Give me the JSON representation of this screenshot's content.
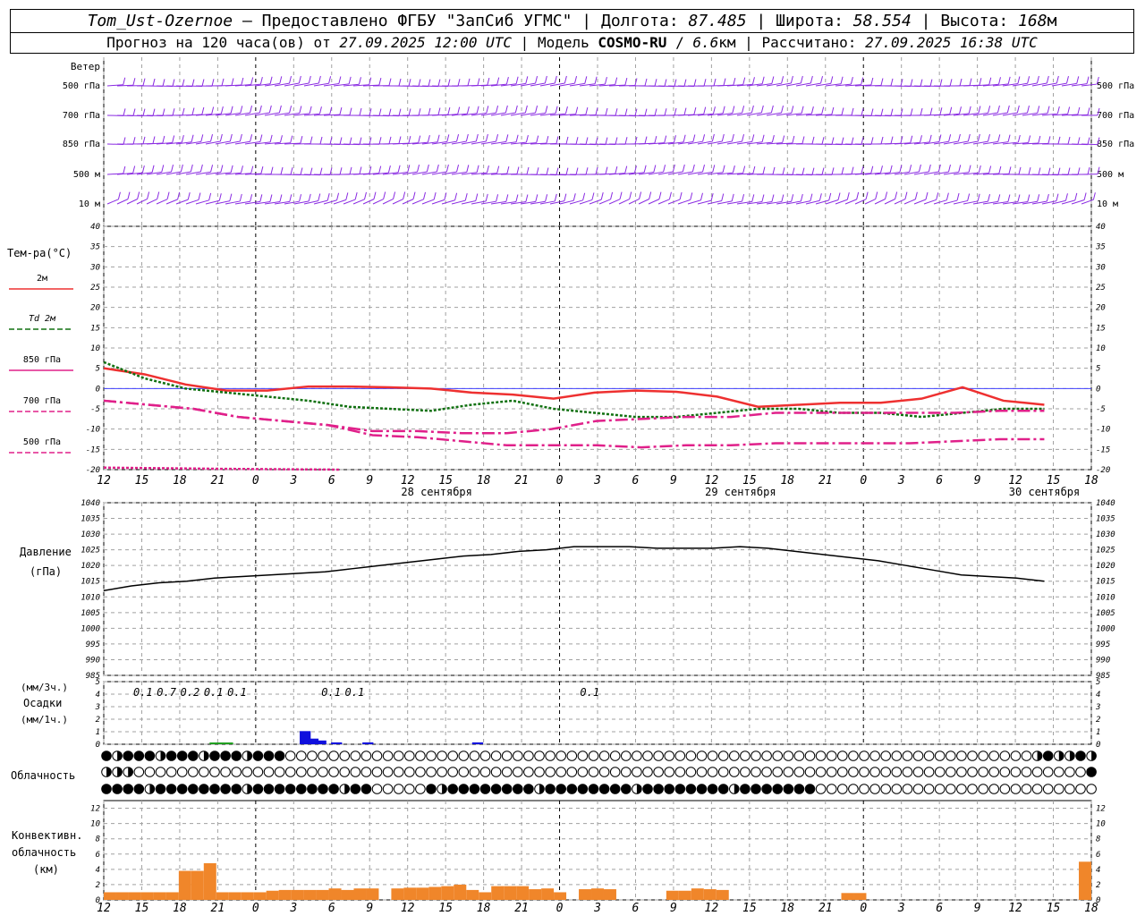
{
  "header": {
    "station": "Tom_Ust-Ozernoe",
    "provider": "Предоставлено ФГБУ \"ЗапСиб УГМС\"",
    "lon_label": "Долгота:",
    "lon_value": "87.485",
    "lat_label": "Широта:",
    "lat_value": "58.554",
    "alt_label": "Высота:",
    "alt_value": "168",
    "alt_unit": "м",
    "forecast_prefix": "Прогноз на 120 часа(ов) от",
    "forecast_time": "27.09.2025 12:00 UTC",
    "model_label": "Модель",
    "model_name": "COSMO-RU",
    "model_res": "6.6",
    "model_res_unit": "км",
    "computed_label": "Рассчитано:",
    "computed_time": "27.09.2025 16:38 UTC",
    "sep": "|",
    "dash": "—"
  },
  "colors": {
    "wind": "#8a2be2",
    "t2m": "#ee3030",
    "td2m": "#107010",
    "t850": "#e0208a",
    "t700": "#e0208a",
    "t500": "#e0208a",
    "pressure": "#000000",
    "precip3h": "#1010dd",
    "precip1h": "#20a020",
    "convective": "#f0862a",
    "grid": "#a0a0a0",
    "zero_line": "#4040ff"
  },
  "chart_data": [
    {
      "panel": "wind",
      "type": "wind_barbs",
      "title": "Ветер",
      "levels": [
        "500 гПа",
        "700 гПа",
        "850 гПа",
        "500 м",
        "10 м"
      ]
    },
    {
      "panel": "temperature",
      "type": "line",
      "ylabel": "Тем-ра(°C)",
      "ylim": [
        -20,
        40
      ],
      "yticks": [
        -20,
        -15,
        -10,
        -5,
        0,
        5,
        10,
        15,
        20,
        25,
        30,
        35,
        40
      ],
      "x_hours": [
        0,
        6,
        12,
        18,
        24,
        30,
        36,
        42,
        48,
        54,
        60,
        66,
        72,
        78,
        84,
        90,
        96,
        102,
        108,
        114,
        120,
        126
      ],
      "series": [
        {
          "name": "2м",
          "key": "t2m",
          "style": "solid",
          "values": [
            5,
            3.5,
            1,
            -0.5,
            -0.5,
            0.5,
            0.5,
            0.3,
            0,
            -1,
            -1.5,
            -2.5,
            -1,
            -0.5,
            -0.8,
            -2,
            -4.5,
            -4,
            -3.5,
            -3.5,
            -2.5,
            0.3,
            -3,
            -4
          ]
        },
        {
          "name": "Td 2м",
          "key": "td2m",
          "style": "dotted",
          "values": [
            6.5,
            2.5,
            0,
            -1,
            -2,
            -3,
            -4.5,
            -5,
            -5.5,
            -4,
            -3,
            -5,
            -6,
            -7,
            -7,
            -6,
            -5,
            -5,
            -6,
            -6,
            -7,
            -6,
            -5,
            -5
          ]
        },
        {
          "name": "850 гПа",
          "key": "t850",
          "style": "dashdot",
          "values": [
            -3,
            -4,
            -5,
            -7,
            -8,
            -9,
            -10.5,
            -10.5,
            -11,
            -11,
            -10,
            -8,
            -7.5,
            -7,
            -7,
            -6,
            -6,
            -6,
            -6,
            -6,
            -5.5,
            -5.5
          ]
        },
        {
          "name": "700 гПа",
          "key": "t700",
          "style": "dashdot",
          "values": [
            -3,
            -4,
            -5,
            -7,
            -8,
            -9,
            -11.5,
            -12,
            -13,
            -14,
            -14,
            -14,
            -14.5,
            -14,
            -14,
            -13.5,
            -13.5,
            -13.5,
            -13.5,
            -13,
            -12.5,
            -12.5
          ]
        },
        {
          "name": "500 гПа",
          "key": "t500",
          "style": "dotted",
          "values": [
            -19.5,
            -19.8,
            -20
          ]
        }
      ]
    },
    {
      "panel": "pressure",
      "type": "line",
      "ylabel": "Давление (гПа)",
      "ylim": [
        985,
        1040
      ],
      "yticks": [
        985,
        990,
        995,
        1000,
        1005,
        1010,
        1015,
        1020,
        1025,
        1030,
        1035,
        1040
      ],
      "series": [
        {
          "name": "",
          "values": [
            1012,
            1013.5,
            1014.5,
            1015,
            1016,
            1016.5,
            1017,
            1017.5,
            1018,
            1019,
            1020,
            1021,
            1022,
            1023,
            1023.5,
            1024.5,
            1025,
            1026,
            1026,
            1026,
            1025.5,
            1025.5,
            1025.5,
            1026,
            1025.5,
            1024.5,
            1023.5,
            1022.5,
            1021.5,
            1020,
            1018.5,
            1017,
            1016.5,
            1016,
            1015
          ]
        }
      ]
    },
    {
      "panel": "precipitation",
      "type": "bar",
      "ylabel_3h": "(мм/3ч.)",
      "title": "Осадки",
      "ylabel_1h": "(мм/1ч.)",
      "ylim": [
        0,
        5
      ],
      "labels": [
        {
          "hour": 5,
          "text": "0.1"
        },
        {
          "hour": 8,
          "text": "0.7"
        },
        {
          "hour": 11,
          "text": "0.2"
        },
        {
          "hour": 14,
          "text": "0.1"
        },
        {
          "hour": 17,
          "text": "0.1"
        },
        {
          "hour": 29,
          "text": "0.1"
        },
        {
          "hour": 32,
          "text": "0.1"
        },
        {
          "hour": 62,
          "text": "0.1"
        }
      ],
      "bars_3h": [
        {
          "hour": 8.5,
          "value": 0.7
        },
        {
          "hour": 9.5,
          "value": 0.3
        },
        {
          "hour": 10.5,
          "value": 0.2
        },
        {
          "hour": 12.5,
          "value": 0.1
        },
        {
          "hour": 16.5,
          "value": 0.1
        },
        {
          "hour": 30.5,
          "value": 0.1
        }
      ],
      "bars_1h": [
        {
          "hour": 4.5,
          "value": 0.05
        },
        {
          "hour": 5.5,
          "value": 0.05
        }
      ]
    },
    {
      "panel": "cloudiness",
      "type": "table",
      "title": "Облачность",
      "rows": [
        "upper",
        "middle",
        "lower"
      ]
    },
    {
      "panel": "convective",
      "type": "bar",
      "ylabel": "Конвективн. облачность (км)",
      "ylim": [
        0,
        13
      ],
      "yticks": [
        0,
        2,
        4,
        6,
        8,
        10,
        12
      ],
      "values": [
        {
          "hour": 0,
          "value": 1
        },
        {
          "hour": 1,
          "value": 1
        },
        {
          "hour": 2,
          "value": 1
        },
        {
          "hour": 3,
          "value": 1
        },
        {
          "hour": 4,
          "value": 1
        },
        {
          "hour": 5,
          "value": 1
        },
        {
          "hour": 6,
          "value": 3.8
        },
        {
          "hour": 7,
          "value": 3.8
        },
        {
          "hour": 8,
          "value": 4.8
        },
        {
          "hour": 9,
          "value": 1
        },
        {
          "hour": 10,
          "value": 1
        },
        {
          "hour": 11,
          "value": 1
        },
        {
          "hour": 12,
          "value": 1
        },
        {
          "hour": 13,
          "value": 1.2
        },
        {
          "hour": 14,
          "value": 1.3
        },
        {
          "hour": 15,
          "value": 1.3
        },
        {
          "hour": 16,
          "value": 1.3
        },
        {
          "hour": 17,
          "value": 1.3
        },
        {
          "hour": 18,
          "value": 1.5
        },
        {
          "hour": 19,
          "value": 1.3
        },
        {
          "hour": 20,
          "value": 1.5
        },
        {
          "hour": 21,
          "value": 1.5
        },
        {
          "hour": 23,
          "value": 1.5
        },
        {
          "hour": 24,
          "value": 1.6
        },
        {
          "hour": 25,
          "value": 1.6
        },
        {
          "hour": 26,
          "value": 1.7
        },
        {
          "hour": 27,
          "value": 1.8
        },
        {
          "hour": 28,
          "value": 2.0
        },
        {
          "hour": 29,
          "value": 1.3
        },
        {
          "hour": 30,
          "value": 1.0
        },
        {
          "hour": 31,
          "value": 1.8
        },
        {
          "hour": 32,
          "value": 1.8
        },
        {
          "hour": 33,
          "value": 1.8
        },
        {
          "hour": 34,
          "value": 1.4
        },
        {
          "hour": 35,
          "value": 1.5
        },
        {
          "hour": 36,
          "value": 1.0
        },
        {
          "hour": 38,
          "value": 1.4
        },
        {
          "hour": 39,
          "value": 1.5
        },
        {
          "hour": 40,
          "value": 1.4
        },
        {
          "hour": 45,
          "value": 1.2
        },
        {
          "hour": 46,
          "value": 1.2
        },
        {
          "hour": 47,
          "value": 1.5
        },
        {
          "hour": 48,
          "value": 1.4
        },
        {
          "hour": 49,
          "value": 1.3
        },
        {
          "hour": 59,
          "value": 0.9
        },
        {
          "hour": 60,
          "value": 0.9
        },
        {
          "hour": 78,
          "value": 5.0
        }
      ]
    }
  ],
  "time_axis": {
    "hour_labels": [
      "12",
      "15",
      "18",
      "21",
      "0",
      "3",
      "6",
      "9",
      "12",
      "15",
      "18",
      "21",
      "0",
      "3",
      "6",
      "9",
      "12",
      "15",
      "18",
      "21",
      "0",
      "3",
      "6",
      "9",
      "12",
      "15",
      "18"
    ],
    "day_labels": [
      {
        "text": "28 сентября",
        "hour_index": 9
      },
      {
        "text": "29 сентября",
        "hour_index": 17
      },
      {
        "text": "30 сентября",
        "hour_index": 25
      }
    ]
  }
}
